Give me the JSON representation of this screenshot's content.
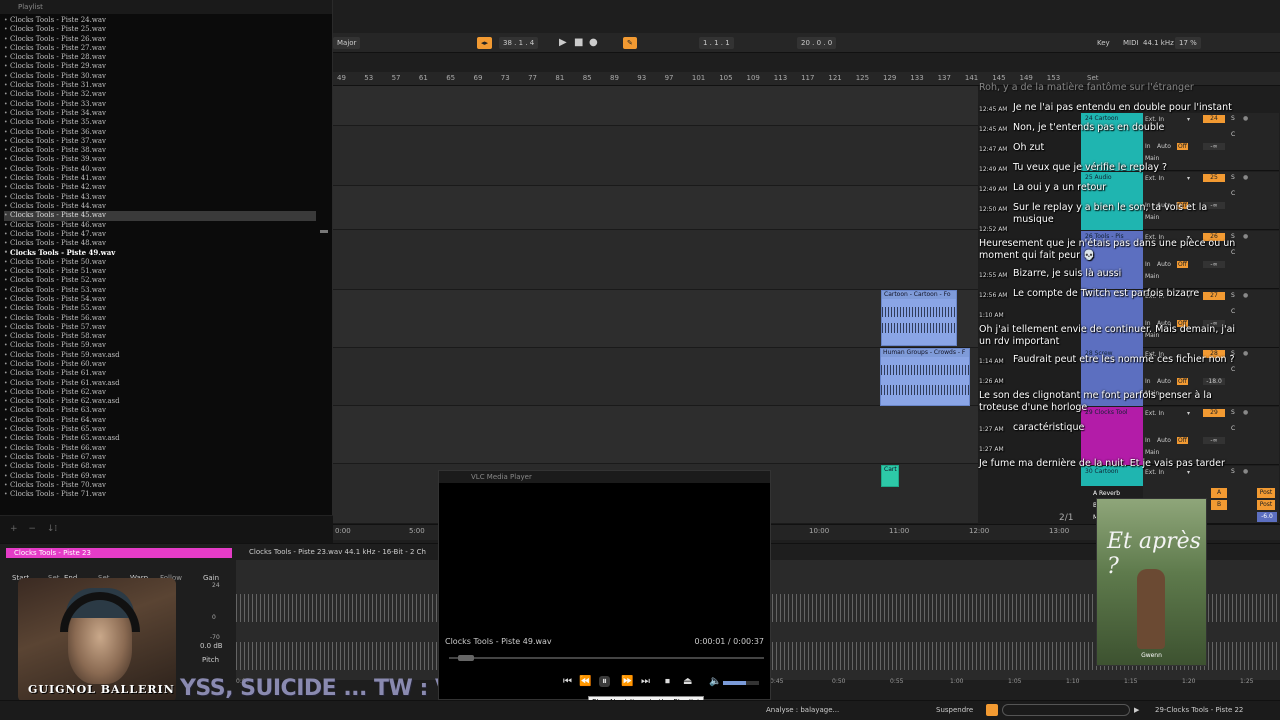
{
  "playlist": {
    "title": "Playlist",
    "items": [
      "Clocks Tools - Piste 24.wav",
      "Clocks Tools - Piste 25.wav",
      "Clocks Tools - Piste 26.wav",
      "Clocks Tools - Piste 27.wav",
      "Clocks Tools - Piste 28.wav",
      "Clocks Tools - Piste 29.wav",
      "Clocks Tools - Piste 30.wav",
      "Clocks Tools - Piste 31.wav",
      "Clocks Tools - Piste 32.wav",
      "Clocks Tools - Piste 33.wav",
      "Clocks Tools - Piste 34.wav",
      "Clocks Tools - Piste 35.wav",
      "Clocks Tools - Piste 36.wav",
      "Clocks Tools - Piste 37.wav",
      "Clocks Tools - Piste 38.wav",
      "Clocks Tools - Piste 39.wav",
      "Clocks Tools - Piste 40.wav",
      "Clocks Tools - Piste 41.wav",
      "Clocks Tools - Piste 42.wav",
      "Clocks Tools - Piste 43.wav",
      "Clocks Tools - Piste 44.wav",
      "Clocks Tools - Piste 45.wav",
      "Clocks Tools - Piste 46.wav",
      "Clocks Tools - Piste 47.wav",
      "Clocks Tools - Piste 48.wav",
      "Clocks Tools - Piste 49.wav",
      "Clocks Tools - Piste 50.wav",
      "Clocks Tools - Piste 51.wav",
      "Clocks Tools - Piste 52.wav",
      "Clocks Tools - Piste 53.wav",
      "Clocks Tools - Piste 54.wav",
      "Clocks Tools - Piste 55.wav",
      "Clocks Tools - Piste 56.wav",
      "Clocks Tools - Piste 57.wav",
      "Clocks Tools - Piste 58.wav",
      "Clocks Tools - Piste 59.wav",
      "Clocks Tools - Piste 59.wav.asd",
      "Clocks Tools - Piste 60.wav",
      "Clocks Tools - Piste 61.wav",
      "Clocks Tools - Piste 61.wav.asd",
      "Clocks Tools - Piste 62.wav",
      "Clocks Tools - Piste 62.wav.asd",
      "Clocks Tools - Piste 63.wav",
      "Clocks Tools - Piste 64.wav",
      "Clocks Tools - Piste 65.wav",
      "Clocks Tools - Piste 65.wav.asd",
      "Clocks Tools - Piste 66.wav",
      "Clocks Tools - Piste 67.wav",
      "Clocks Tools - Piste 68.wav",
      "Clocks Tools - Piste 69.wav",
      "Clocks Tools - Piste 70.wav",
      "Clocks Tools - Piste 71.wav"
    ],
    "selected_index": 21,
    "current_index": 25,
    "bottom_icons": [
      "+",
      "−",
      "↓⁞"
    ]
  },
  "transport": {
    "scale": "Major",
    "position": "38 . 1 . 4",
    "loop_start": "1 . 1 . 1",
    "loop_length": "20 . 0 . 0",
    "key_label": "Key",
    "midi_label": "MIDI",
    "sample_rate": "44.1 kHz",
    "cpu": "17 %"
  },
  "ruler": {
    "bars": [
      "49",
      "53",
      "57",
      "61",
      "65",
      "69",
      "73",
      "77",
      "81",
      "85",
      "89",
      "93",
      "97",
      "101",
      "105",
      "109",
      "113",
      "117",
      "121",
      "125",
      "129",
      "133",
      "137",
      "141",
      "145",
      "149",
      "153"
    ],
    "set_label": "Set"
  },
  "time_ruler": {
    "labels": [
      "0:00",
      "5:00",
      "10:00",
      "11:00",
      "12:00",
      "13:00"
    ],
    "page": "2/1"
  },
  "clips": [
    {
      "title": "Cartoon - Cartoon - Fo"
    },
    {
      "title": "Human Groups - Crowds - F"
    },
    {
      "title": "Cart"
    }
  ],
  "mixer": [
    {
      "name": "24 Cartoon",
      "number": "24",
      "input": "Ext. In",
      "color": "#1fb5b0",
      "send": "Main"
    },
    {
      "name": "25 Audio",
      "number": "25",
      "input": "Ext. In",
      "color": "#1fb5b0",
      "send": "Main"
    },
    {
      "name": "26 Tools - Pis",
      "number": "26",
      "input": "Ext. In",
      "color": "#5c6fc0",
      "send": "Main"
    },
    {
      "name": "27",
      "number": "27",
      "input": "Ext. In",
      "color": "#5c6fc0",
      "send": "Main"
    },
    {
      "name": "28 Screw",
      "number": "28",
      "input": "Ext. In",
      "color": "#5c6fc0",
      "send": "Main",
      "volume": "-18.0"
    },
    {
      "name": "29 Clocks Tool",
      "number": "29",
      "input": "Ext. In",
      "color": "#b31ca8",
      "send": "Main"
    },
    {
      "name": "30 Cartoon",
      "number": "",
      "input": "Ext. In",
      "color": "#1fb5b0",
      "send": ""
    }
  ],
  "returns": [
    {
      "name": "A Reverb",
      "letter": "A",
      "post": "Post"
    },
    {
      "name": "B",
      "letter": "B",
      "post": "Post"
    },
    {
      "name": "Main",
      "letter": "",
      "post": "",
      "volume": "-6.0"
    }
  ],
  "mixer_labels": {
    "in": "In",
    "auto": "Auto",
    "off": "Off",
    "s": "S",
    "c": "C",
    "minus_inf": "-∞"
  },
  "chat": [
    {
      "time": "",
      "msg": "Roh, y a de la matière fantôme sur l'étranger"
    },
    {
      "time": "12:45 AM",
      "msg": "Je ne l'ai pas entendu en double pour l'instant"
    },
    {
      "time": "12:45 AM",
      "msg": "Non, je t'entends pas en double"
    },
    {
      "time": "12:47 AM",
      "msg": "Oh zut"
    },
    {
      "time": "12:49 AM",
      "msg": "Tu veux que je vérifie le replay ?"
    },
    {
      "time": "12:49 AM",
      "msg": "La oui y a un retour"
    },
    {
      "time": "12:50 AM",
      "msg": "Sur le replay y a bien le son, ta vois et la musique"
    },
    {
      "time": "12:52 AM",
      "msg": ""
    },
    {
      "time": "",
      "msg": "Heuresement que je n'étais pas dans une pièce ou un moment qui fait peur 💀"
    },
    {
      "time": "12:55 AM",
      "msg": "Bizarre, je suis là aussi"
    },
    {
      "time": "12:56 AM",
      "msg": "Le compte de Twitch est parfois bizarre"
    },
    {
      "time": "1:10 AM",
      "msg": ""
    },
    {
      "time": "",
      "msg": "Oh j'ai tellement envie de continuer. Mais demain, j'ai un rdv important"
    },
    {
      "time": "1:14 AM",
      "msg": "Faudrait peut etre les nommé ces fichier non ?"
    },
    {
      "time": "1:26 AM",
      "msg": ""
    },
    {
      "time": "",
      "msg": "Le son des clignotant me font parfois penser à la troteuse d'une horloge"
    },
    {
      "time": "1:27 AM",
      "msg": "caractéristique"
    },
    {
      "time": "1:27 AM",
      "msg": ""
    },
    {
      "time": "",
      "msg": "Je fume ma dernière de la nuit. Et je vais pas tarder"
    }
  ],
  "clipview": {
    "clip_name": "Clocks Tools - Piste 23",
    "sample_info": "Clocks Tools - Piste 23.wav  44.1 kHz - 16-Bit - 2 Ch",
    "start_label": "Start",
    "set_label": "Set",
    "end_label": "End",
    "warp_label": "Warp",
    "follow_label": "Follow",
    "gain_label": "Gain",
    "gain_value": "0.0 dB",
    "pitch_label": "Pitch",
    "gain_scale": [
      "24",
      "0",
      "-70"
    ],
    "time_labels": [
      "0:00",
      "0:45",
      "0:50",
      "0:55",
      "1:00",
      "1:05",
      "1:10",
      "1:15",
      "1:20",
      "1:25"
    ]
  },
  "vlc": {
    "title": "VLC Media Player",
    "now_playing": "Clocks Tools - Piste 49.wav",
    "time": "0:00:01 / 0:00:37",
    "seek_fraction": 0.027,
    "volume_fraction": 0.65,
    "tooltip": "Play Next Item in the Playlist"
  },
  "webcam": {
    "name": "GUIGNOL BALLERIN"
  },
  "book": {
    "title": "Et après ?",
    "author": "Gwenn"
  },
  "ticker": "YSS, SUICIDE ... TW : VIOL &",
  "statusbar": {
    "analysis": "Analyse : balayage...",
    "suspend": "Suspendre",
    "track": "29-Clocks Tools - Piste 22"
  }
}
